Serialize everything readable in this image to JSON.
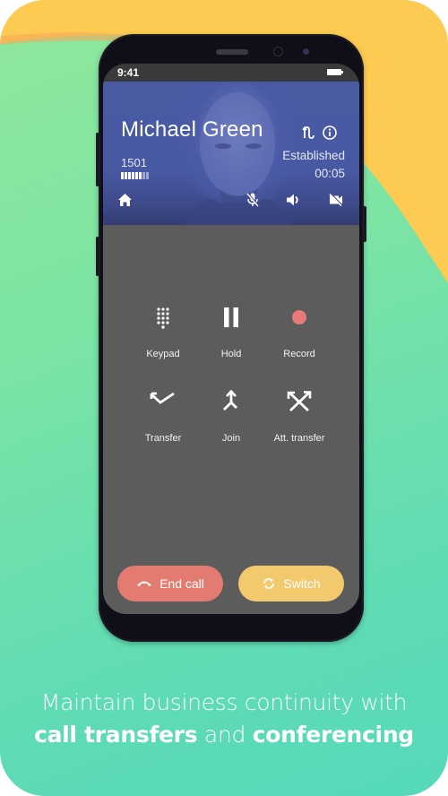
{
  "colors": {
    "yellow_bg": "#fecb52",
    "green_bg": "#7ae3a5",
    "hero_blue": "#4a5aa6",
    "panel_gray": "#5c5c5c",
    "end_call": "#e47b70",
    "switch": "#f2c96d",
    "record_dot": "#e87a7c"
  },
  "status_bar": {
    "time": "9:41",
    "battery_icon": "battery-icon"
  },
  "call": {
    "contact_name": "Michael Green",
    "extension": "1501",
    "signal_level_bars": 6,
    "signal_total_bars": 8,
    "state": "Established",
    "duration": "00:05",
    "header_icons": [
      "codec-swap-icon",
      "info-icon"
    ],
    "toolbar_icons": [
      "home-icon",
      "mic-muted-icon",
      "speaker-icon",
      "video-off-icon"
    ]
  },
  "actions": [
    {
      "label": "Keypad",
      "icon": "keypad-icon"
    },
    {
      "label": "Hold",
      "icon": "pause-icon"
    },
    {
      "label": "Record",
      "icon": "record-icon"
    },
    {
      "label": "Transfer",
      "icon": "transfer-icon"
    },
    {
      "label": "Join",
      "icon": "merge-icon"
    },
    {
      "label": "Att. transfer",
      "icon": "attended-transfer-icon"
    }
  ],
  "buttons": {
    "end_call": {
      "label": "End call",
      "icon": "hang-up-icon"
    },
    "switch": {
      "label": "Switch",
      "icon": "sync-icon"
    }
  },
  "caption": {
    "line1": "Maintain business continuity with",
    "bold1": "call transfers",
    "mid": " and ",
    "bold2": "conferencing"
  }
}
